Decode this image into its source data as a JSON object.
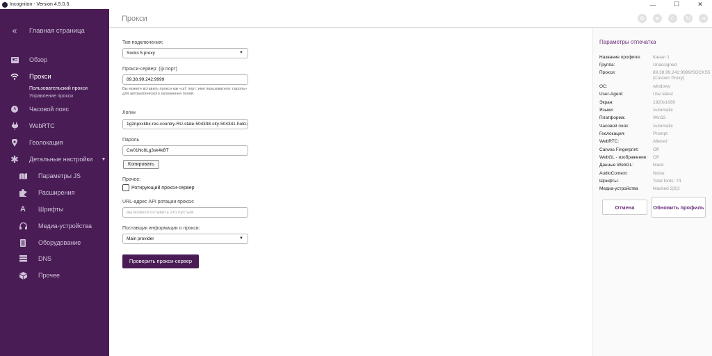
{
  "window": {
    "title": "Incogniton - Version 4.5.0.3",
    "minimize": "—",
    "maximize": "☐",
    "close": "✕"
  },
  "sidebar": {
    "collapse_icon": "«",
    "home": "Главная страница",
    "items": [
      {
        "label": "Обзор",
        "icon": "overview-icon"
      },
      {
        "label": "Прокси",
        "icon": "wifi-icon"
      },
      {
        "label": "Часовой пояс",
        "icon": "clock-icon"
      },
      {
        "label": "WebRTC",
        "icon": "plug-icon"
      },
      {
        "label": "Геолокация",
        "icon": "location-pin-icon"
      },
      {
        "label": "Детальные настройки",
        "icon": "asterisk-icon"
      }
    ],
    "proxy_subitems": [
      "Пользовательский прокси",
      "Управление прокси"
    ],
    "detail_items": [
      {
        "label": "Параметры JS",
        "icon": "map-icon"
      },
      {
        "label": "Расширения",
        "icon": "puzzle-icon"
      },
      {
        "label": "Шрифты",
        "icon": "font-icon"
      },
      {
        "label": "Медиа-устройства",
        "icon": "headphones-icon"
      },
      {
        "label": "Оборудование",
        "icon": "hardware-icon"
      },
      {
        "label": "DNS",
        "icon": "server-icon"
      },
      {
        "label": "Прочее",
        "icon": "cube-icon"
      }
    ]
  },
  "header": {
    "title": "Прокси"
  },
  "form": {
    "connection_type_label": "Тип подключения:",
    "connection_type_value": "Socks 5 proxy",
    "proxy_server_label": "Прокси-сервер: (ip:порт)",
    "proxy_server_value": "89.38.99.242:9999",
    "proxy_hint": "Вы можете вставить прокси как «url: порт: имя пользователя: пароль» для автоматического заполнения полей.",
    "login_label": "Логин",
    "login_value": "1g2npxxkbx-res-country-RU-state-504338-city-504341-hold-s",
    "password_label": "Пароль",
    "password_value": "Cw01Nc8Lg3sk4kBT",
    "copy_button": "Копировать",
    "other_label": "Прочее:",
    "rotating_checkbox_label": "Ротирующий прокси-сервер",
    "rotating_checked": false,
    "rotation_url_label": "URL-адрес API ротации прокси:",
    "rotation_url_placeholder": "вы можете оставить это пустым",
    "provider_label": "Поставщик информации о прокси:",
    "provider_value": "Main provider",
    "check_button": "Проверить прокси-сервер"
  },
  "panel": {
    "title": "Параметры отпечатка",
    "rows": [
      {
        "key": "Название профиля:",
        "value": "Канал 1"
      },
      {
        "key": "Группа:",
        "value": "Unassigned"
      },
      {
        "key": "Прокси:",
        "value": "89.38.99.242:9999/SOCKS5 ...",
        "value2": "(Custom Proxy)"
      },
      {
        "key": "ОС:",
        "value": "windows"
      },
      {
        "key": "User-Agent:",
        "value": "Use latest"
      },
      {
        "key": "Экран:",
        "value": "1920x1080"
      },
      {
        "key": "Языки:",
        "value": "Automatic"
      },
      {
        "key": "Платформа:",
        "value": "Win32"
      },
      {
        "key": "Часовой пояс:",
        "value": "Automatic"
      },
      {
        "key": "Геолокация:",
        "value": "Prompt"
      },
      {
        "key": "WebRTC:",
        "value": "Altered"
      },
      {
        "key": "Canvas Fingerprint:",
        "value": "Off"
      },
      {
        "key": "WebGL - изображение:",
        "value": "Off"
      },
      {
        "key": "Данные WebGL:",
        "value": "Mask"
      },
      {
        "key": "AudioContext:",
        "value": "Noise"
      },
      {
        "key": "Шрифты:",
        "value": "Total fonts: 74"
      },
      {
        "key": "Медиа-устройства",
        "value": "Masked 2|2|2"
      }
    ],
    "cancel_button": "Отмена",
    "update_button": "Обновить профиль"
  },
  "colors": {
    "sidebar_bg": "#4a1c56",
    "accent": "#6a2f7a",
    "primary_button": "#4a1c56"
  }
}
